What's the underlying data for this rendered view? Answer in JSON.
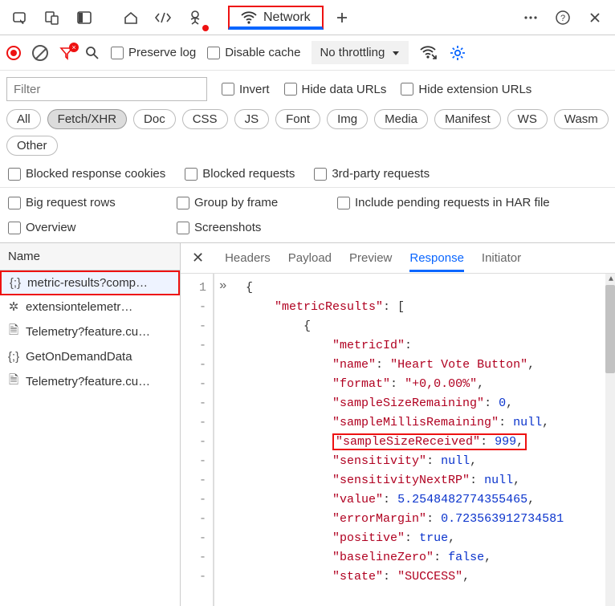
{
  "top": {
    "tab_label": "Network"
  },
  "toolbar": {
    "preserve": "Preserve log",
    "disable_cache": "Disable cache",
    "throttle": "No throttling"
  },
  "filter": {
    "placeholder": "Filter",
    "invert": "Invert",
    "hide_data": "Hide data URLs",
    "hide_ext": "Hide extension URLs"
  },
  "pills": [
    "All",
    "Fetch/XHR",
    "Doc",
    "CSS",
    "JS",
    "Font",
    "Img",
    "Media",
    "Manifest",
    "WS",
    "Wasm",
    "Other"
  ],
  "pill_active_index": 1,
  "checks": {
    "blocked_cookies": "Blocked response cookies",
    "blocked_req": "Blocked requests",
    "third_party": "3rd-party requests",
    "big_req": "Big request rows",
    "group_frame": "Group by frame",
    "include_har": "Include pending requests in HAR file",
    "overview": "Overview",
    "screenshots": "Screenshots"
  },
  "sidebar": {
    "header": "Name",
    "items": [
      {
        "icon": "json",
        "label": "metric-results?comp…",
        "selected": true
      },
      {
        "icon": "gear",
        "label": "extensiontelemetr…"
      },
      {
        "icon": "file",
        "label": "Telemetry?feature.cu…"
      },
      {
        "icon": "json",
        "label": "GetOnDemandData"
      },
      {
        "icon": "file",
        "label": "Telemetry?feature.cu…"
      }
    ]
  },
  "tabs": [
    "Headers",
    "Payload",
    "Preview",
    "Response",
    "Initiator"
  ],
  "tab_active_index": 3,
  "gutter_first": "1",
  "code": {
    "line1_brace": "{",
    "key_mr": "\"metricResults\"",
    "brack": ": [",
    "brace2": "{",
    "entries": [
      {
        "k": "\"metricId\"",
        "v": ":",
        "type": "bare"
      },
      {
        "k": "\"name\"",
        "v": ": \"Heart Vote Button\",",
        "type": "s"
      },
      {
        "k": "\"format\"",
        "v": ": \"+0,0.00%\",",
        "type": "s"
      },
      {
        "k": "\"sampleSizeRemaining\"",
        "v": ": 0,",
        "type": "n"
      },
      {
        "k": "\"sampleMillisRemaining\"",
        "v": ": null,",
        "type": "b"
      },
      {
        "k": "\"sampleSizeReceived\"",
        "v": ": 999,",
        "type": "n",
        "hl": true
      },
      {
        "k": "\"sensitivity\"",
        "v": ": null,",
        "type": "b"
      },
      {
        "k": "\"sensitivityNextRP\"",
        "v": ": null,",
        "type": "b"
      },
      {
        "k": "\"value\"",
        "v": ": 5.2548482774355465,",
        "type": "n"
      },
      {
        "k": "\"errorMargin\"",
        "v": ": 0.723563912734581",
        "type": "n"
      },
      {
        "k": "\"positive\"",
        "v": ": true,",
        "type": "b"
      },
      {
        "k": "\"baselineZero\"",
        "v": ": false,",
        "type": "b"
      },
      {
        "k": "\"state\"",
        "v": ": \"SUCCESS\",",
        "type": "s"
      }
    ]
  }
}
